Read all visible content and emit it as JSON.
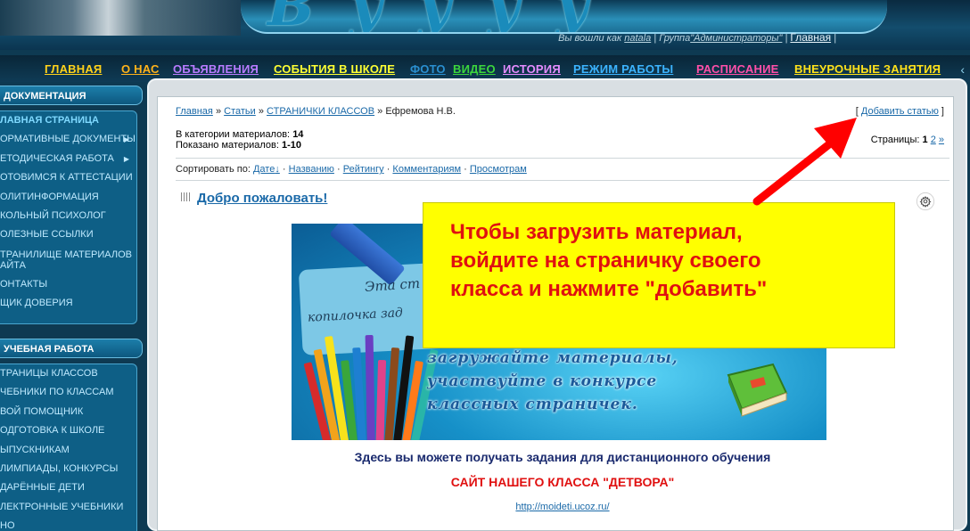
{
  "header": {
    "logged_as_prefix": "Вы вошли как",
    "username": "natala",
    "group_prefix": "Группа",
    "group": "\"Администраторы\"",
    "home_link": "Главная"
  },
  "topnav": [
    {
      "label": "ГЛАВНАЯ",
      "color": "#ffd21a"
    },
    {
      "label": "О НАС",
      "color": "#ffb31a"
    },
    {
      "label": "ОБЪЯВЛЕНИЯ",
      "color": "#b87bff"
    },
    {
      "label": "СОБЫТИЯ В ШКОЛЕ",
      "color": "#ffff33"
    },
    {
      "label": "ФОТО",
      "color": "#2a8fd0"
    },
    {
      "label": "ВИДЕО",
      "color": "#3cd63c"
    },
    {
      "label": "ИСТОРИЯ",
      "color": "#e68cff"
    },
    {
      "label": "РЕЖИМ РАБОТЫ",
      "color": "#3cb4ff"
    },
    {
      "label": "РАСПИСАНИЕ",
      "color": "#ff4fa8"
    },
    {
      "label": "ВНЕУРОЧНЫЕ ЗАНЯТИЯ",
      "color": "#ffe21a"
    }
  ],
  "sidebar": {
    "doc_title": "ДОКУМЕНТАЦИЯ",
    "doc_items": [
      "ЛАВНАЯ СТРАНИЦА",
      "ОРМАТИВНЫЕ ДОКУМЕНТЫ",
      "ЕТОДИЧЕСКАЯ РАБОТА",
      "ОТОВИМСЯ К АТТЕСТАЦИИ",
      "ОЛИТИНФОРМАЦИЯ",
      "КОЛЬНЫЙ ПСИХОЛОГ",
      "ОЛЕЗНЫЕ ССЫЛКИ",
      "ТРАНИЛИЩЕ МАТЕРИАЛОВ АЙТА",
      "ОНТАКТЫ",
      "ЩИК ДОВЕРИЯ"
    ],
    "study_title": "УЧЕБНАЯ РАБОТА",
    "study_items": [
      "ТРАНИЦЫ КЛАССОВ",
      "ЧЕБНИКИ ПО КЛАССАМ",
      "ВОЙ ПОМОЩНИК",
      "ОДГОТОВКА К ШКОЛЕ",
      "ЫПУСКНИКАМ",
      "ЛИМПИАДЫ, КОНКУРСЫ",
      "ДАРЁННЫЕ ДЕТИ",
      "ЛЕКТРОННЫЕ УЧЕБНИКИ",
      "НО"
    ]
  },
  "content": {
    "breadcrumb": [
      "Главная",
      "Статьи",
      "СТРАНИЧКИ КЛАССОВ"
    ],
    "breadcrumb_sep": "»",
    "breadcrumb_current": "Ефремова Н.В.",
    "add_article": "Добавить статью",
    "materials_in_category_label": "В категории материалов:",
    "materials_in_category": "14",
    "shown_label": "Показано материалов:",
    "shown": "1-10",
    "pages_label": "Страницы:",
    "page_current": "1",
    "page_next": "2",
    "page_next_arrow": "»",
    "sort_label": "Сортировать по:",
    "sort_options": [
      "Дате",
      "Названию",
      "Рейтингу",
      "Комментариям",
      "Просмотрам"
    ],
    "sort_sep": "·",
    "entry_title": "Добро пожаловать!",
    "banner": {
      "note_line1": "Эта ст",
      "note_line2": "копилочка зад",
      "slogan_line1": "загружайте материалы,",
      "slogan_line2": "участвуйте в конкурсе",
      "slogan_line3": "классных страничек."
    },
    "caption1": "Здесь вы можете получать задания для дистанционного обучения",
    "caption2": "САЙТ НАШЕГО КЛАССА \"ДЕТВОРА\"",
    "link": "http://moideti.ucoz.ru/"
  },
  "callout": {
    "line1": "Чтобы загрузить материал,",
    "line2": "войдите на страничку своего",
    "line3": "класса и нажмите \"добавить\""
  },
  "colors": {
    "accent_link": "#1a69a8",
    "callout_bg": "#ffff00",
    "callout_text": "#e01010",
    "arrow": "#ff0000"
  }
}
